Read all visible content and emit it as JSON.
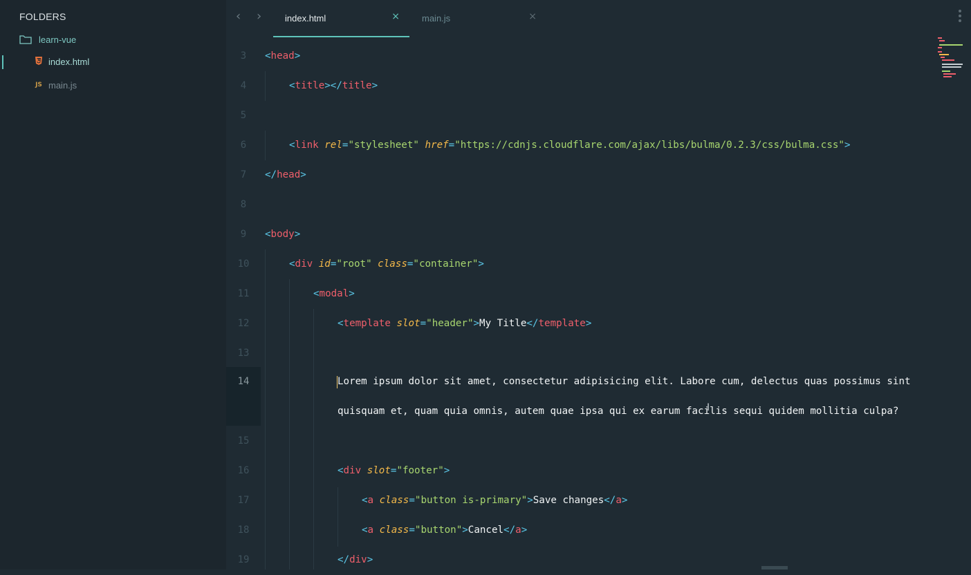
{
  "sidebar": {
    "title": "FOLDERS",
    "folder": "learn-vue",
    "files": [
      {
        "name": "index.html",
        "icon": "html5-icon",
        "active": true
      },
      {
        "name": "main.js",
        "icon": "js-icon",
        "active": false
      }
    ]
  },
  "tabs": [
    {
      "label": "index.html",
      "active": true
    },
    {
      "label": "main.js",
      "active": false
    }
  ],
  "icons": {
    "back": "‹",
    "forward": "›",
    "close": "×"
  },
  "colors": {
    "background": "#1f2b33",
    "sidebar": "#1c262d",
    "accent": "#5fc4bb",
    "tag": "#ef5f6b",
    "punctuation": "#5cc8e8",
    "attribute": "#f4b94a",
    "string": "#a8d66f"
  },
  "editor": {
    "line_numbers": [
      "3",
      "4",
      "5",
      "6",
      "7",
      "8",
      "9",
      "10",
      "11",
      "12",
      "13",
      "14",
      "15",
      "16",
      "17",
      "18",
      "19"
    ],
    "active_line": "14",
    "lines": {
      "l3": [
        "<",
        "head",
        ">"
      ],
      "l4": [
        "<",
        "title",
        "></",
        "title",
        ">"
      ],
      "l6": [
        "<",
        "link",
        " ",
        "rel",
        "=",
        "\"stylesheet\"",
        " ",
        "href",
        "=",
        "\"https://cdnjs.cloudflare.com/ajax/libs/bulma/0.2.3/css/bulma.css\"",
        ">"
      ],
      "l7": [
        "</",
        "head",
        ">"
      ],
      "l9": [
        "<",
        "body",
        ">"
      ],
      "l10": [
        "<",
        "div",
        " ",
        "id",
        "=",
        "\"root\"",
        " ",
        "class",
        "=",
        "\"container\"",
        ">"
      ],
      "l11": [
        "<",
        "modal",
        ">"
      ],
      "l12": [
        "<",
        "template",
        " ",
        "slot",
        "=",
        "\"header\"",
        ">",
        "My Title",
        "</",
        "template",
        ">"
      ],
      "l14a": "Lorem ipsum dolor sit amet, consectetur adipisicing elit. Labore cum, delectus quas possimus sint",
      "l14b": "quisquam et, quam quia omnis, autem quae ipsa qui ex earum facilis sequi quidem mollitia culpa?",
      "l16": [
        "<",
        "div",
        " ",
        "slot",
        "=",
        "\"footer\"",
        ">"
      ],
      "l17": [
        "<",
        "a",
        " ",
        "class",
        "=",
        "\"button is-primary\"",
        ">",
        "Save changes",
        "</",
        "a",
        ">"
      ],
      "l18": [
        "<",
        "a",
        " ",
        "class",
        "=",
        "\"button\"",
        ">",
        "Cancel",
        "</",
        "a",
        ">"
      ],
      "l19": [
        "</",
        "div",
        ">"
      ]
    }
  }
}
